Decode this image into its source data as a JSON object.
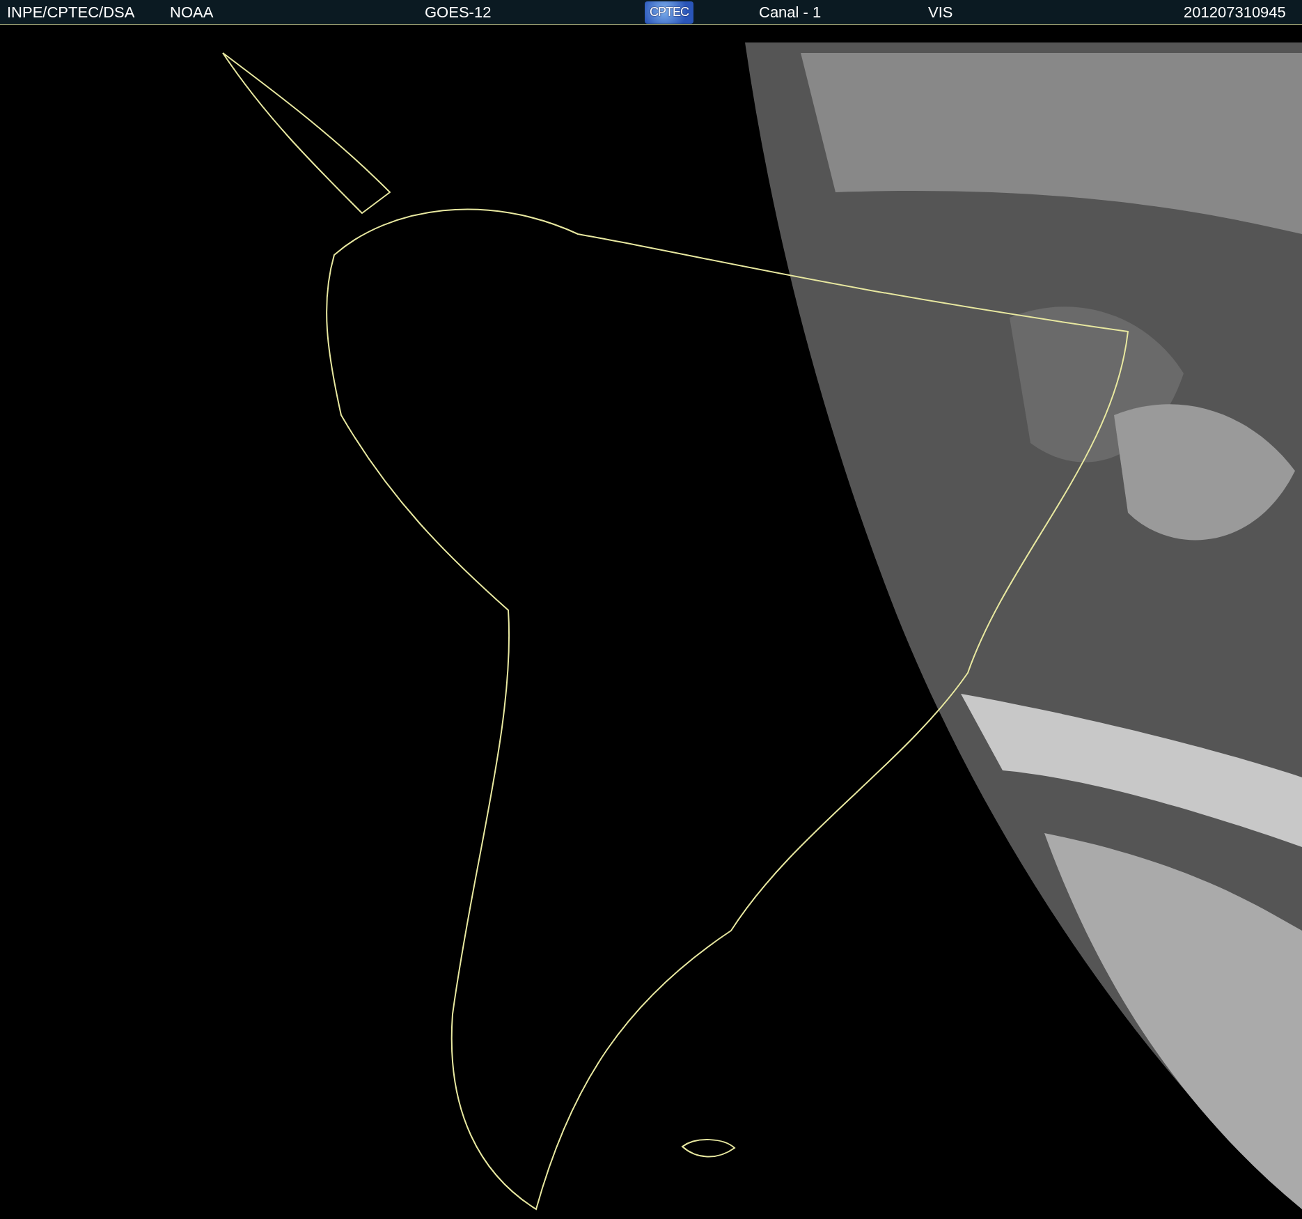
{
  "header": {
    "source": "INPE/CPTEC/DSA",
    "agency": "NOAA",
    "satellite": "GOES-12",
    "logo": "CPTEC",
    "channel": "Canal - 1",
    "band": "VIS",
    "timestamp": "201207310945"
  }
}
